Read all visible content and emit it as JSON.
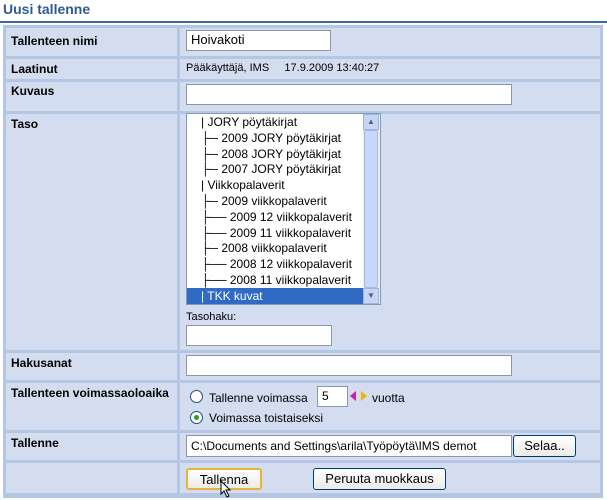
{
  "page_title": "Uusi tallenne",
  "fields": {
    "name": {
      "label": "Tallenteen nimi",
      "value": "Hoivakoti"
    },
    "created": {
      "label": "Laatinut",
      "value": "Pääkäyttäjä, IMS     17.9.2009 13:40:27"
    },
    "description": {
      "label": "Kuvaus",
      "value": ""
    },
    "level": {
      "label": "Taso",
      "items": [
        "JORY pöytäkirjat",
        "2009 JORY pöytäkirjat",
        "2008 JORY pöytäkirjat",
        "2007 JORY pöytäkirjat",
        "Viikkopalaverit",
        "2009 viikkopalaverit",
        "2009 12 viikkopalaverit",
        "2009 11 viikkopalaverit",
        "2008 viikkopalaverit",
        "2008 12 viikkopalaverit",
        "2008 11 viikkopalaverit",
        "TKK kuvat"
      ],
      "prefixes": [
        "| ",
        "├─ ",
        "├─ ",
        "├─ ",
        "| ",
        "├─ ",
        "├── ",
        "├── ",
        "├─ ",
        "├── ",
        "├── ",
        "| "
      ],
      "selected": "TKK kuvat",
      "search_label": "Tasohaku:",
      "search_value": ""
    },
    "keywords": {
      "label": "Hakusanat",
      "value": ""
    },
    "validity": {
      "label": "Tallenteen voimassaoloaika",
      "option1_prefix": "Tallenne voimassa",
      "years_value": "5",
      "option1_suffix": "vuotta",
      "option2": "Voimassa toistaiseksi",
      "selected": "option2"
    },
    "file": {
      "label": "Tallenne",
      "value": "C:\\Documents and Settings\\arila\\Työpöytä\\IMS demot",
      "browse": "Selaa.."
    }
  },
  "actions": {
    "save": "Tallenna",
    "cancel": "Peruuta muokkaus"
  },
  "colors": {
    "title": "#2e5b8c",
    "border": "#b3c6e4",
    "cell": "#d3ddef",
    "selection": "#316ac5"
  }
}
